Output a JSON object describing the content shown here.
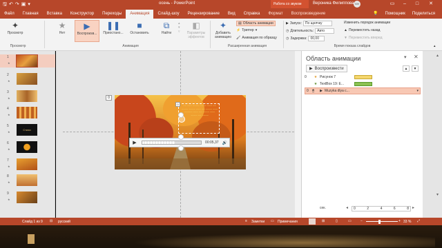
{
  "window": {
    "title": "осень  -  PowerPoint",
    "context_tab": "Работа со звуком",
    "user_name": "Вероника Филиппова",
    "user_initials": "ВФ"
  },
  "tabs": [
    "Файл",
    "Главная",
    "Вставка",
    "Конструктор",
    "Переходы",
    "Анимация",
    "Слайд-шоу",
    "Рецензирование",
    "Вид",
    "Справка",
    "Формат",
    "Воспроизведение"
  ],
  "active_tab": "Анимация",
  "help": "Помощник",
  "share": "Поделиться",
  "ribbon": {
    "preview": "Просмотр",
    "effects": [
      "Нет",
      "Воспроизв...",
      "Приостано...",
      "Остановить",
      "Найти"
    ],
    "effect_params": "Параметры эффектов",
    "add_anim": "Добавить анимацию",
    "anim_pane": "Область анимации",
    "trigger": "Триггер",
    "painter": "Анимация по образцу",
    "start_label": "Запуск:",
    "start_value": "По щелчку",
    "duration_label": "Длительность:",
    "duration_value": "Авто",
    "delay_label": "Задержка:",
    "delay_value": "00,00",
    "reorder": "Изменить порядок анимации",
    "move_back": "Переместить назад",
    "move_fwd": "Переместить вперед",
    "groups": [
      "Просмотр",
      "Анимация",
      "Расширенная анимация",
      "Время показа слайдов"
    ]
  },
  "thumbnails": [
    "1",
    "2",
    "3",
    "4",
    "5",
    "6",
    "7",
    "8",
    "9"
  ],
  "slide5_text": "Стихи",
  "slide": {
    "marker": "0",
    "overlay_marker": "0",
    "player_time": "00:05,37"
  },
  "anim_pane": {
    "title": "Область анимации",
    "play_button": "Воспроизвести",
    "items": [
      {
        "num": "0",
        "name": "Рисунок 7"
      },
      {
        "num": "",
        "name": "TextBox 19: E..."
      },
      {
        "num": "0",
        "name": "Muzyka dlya c..."
      }
    ],
    "seconds_label": "сек.",
    "timeline_ticks": [
      "0",
      "2",
      "4",
      "6",
      "8"
    ]
  },
  "status": {
    "slide_info": "Слайд 1 из 9",
    "language": "русский",
    "notes": "Заметки",
    "comments": "Примечания",
    "zoom": "33 %"
  },
  "colors": {
    "accent": "#b7472a",
    "bar_item1": "#f5d76e",
    "bar_item2": "#8cc152"
  }
}
